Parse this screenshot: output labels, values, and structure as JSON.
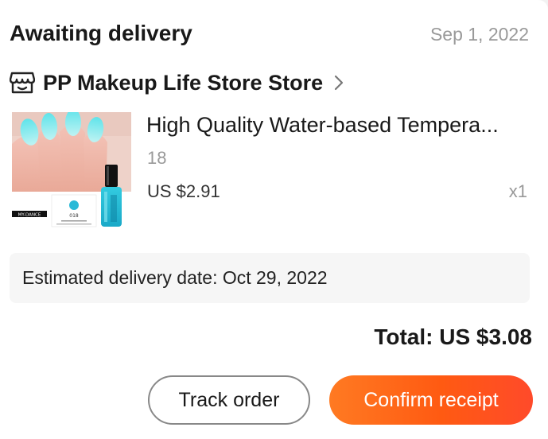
{
  "order": {
    "status": "Awaiting delivery",
    "date": "Sep 1, 2022"
  },
  "store": {
    "icon": "store-icon",
    "name": "PP Makeup Life Store Store",
    "chevron": "chevron-right-icon"
  },
  "product": {
    "title": "High Quality Water-based Tempera...",
    "variant": "18",
    "price": "US $2.91",
    "quantity": "x1",
    "image": {
      "brand": "MY-DANCE",
      "bottle_number": "018"
    }
  },
  "delivery": {
    "text": "Estimated delivery date: Oct 29, 2022"
  },
  "total": {
    "text": "Total: US $3.08"
  },
  "actions": {
    "track_label": "Track order",
    "confirm_label": "Confirm receipt"
  },
  "colors": {
    "accent": "#ff5a12",
    "muted_text": "#999999",
    "panel": "#f6f6f6"
  }
}
